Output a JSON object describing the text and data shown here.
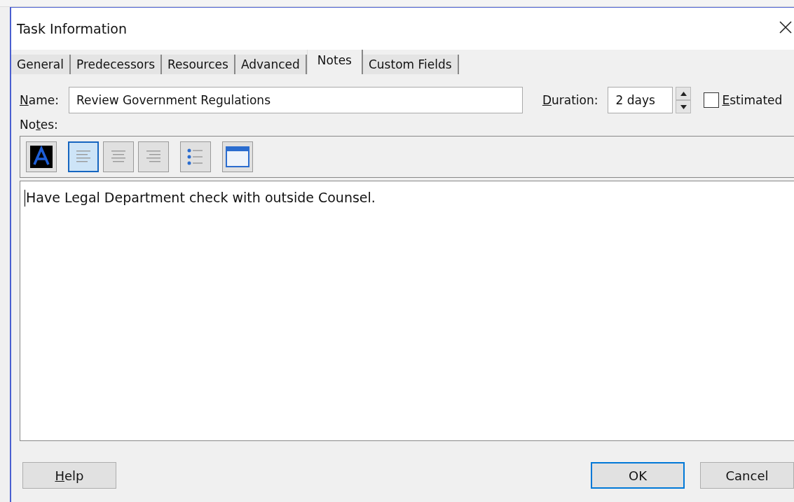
{
  "window": {
    "title": "Task Information"
  },
  "tabs": [
    {
      "label": "General",
      "selected": false
    },
    {
      "label": "Predecessors",
      "selected": false
    },
    {
      "label": "Resources",
      "selected": false
    },
    {
      "label": "Advanced",
      "selected": false
    },
    {
      "label": "Notes",
      "selected": true
    },
    {
      "label": "Custom Fields",
      "selected": false
    }
  ],
  "name_field": {
    "label": {
      "key": "N",
      "rest": "ame:"
    },
    "value": "Review Government Regulations"
  },
  "duration_field": {
    "label": {
      "key": "D",
      "rest": "uration:"
    },
    "value": "2 days"
  },
  "estimated": {
    "label": {
      "key": "E",
      "rest": "stimated"
    },
    "checked": false
  },
  "notes_label": {
    "lead": "No",
    "key": "t",
    "rest": "es:"
  },
  "toolbar": [
    {
      "kind": "font",
      "selected": false
    },
    {
      "kind": "align-left",
      "selected": true
    },
    {
      "kind": "align-center",
      "selected": false
    },
    {
      "kind": "align-right",
      "selected": false
    },
    {
      "kind": "bullets",
      "selected": false
    },
    {
      "kind": "object",
      "selected": false
    }
  ],
  "notes_text": "Have Legal Department check with outside Counsel.",
  "help_button": {
    "label": {
      "key": "H",
      "rest": "elp"
    },
    "default": false
  },
  "buttons": [
    {
      "label": {
        "rest": "OK"
      },
      "default": true
    },
    {
      "label": {
        "rest": "Cancel"
      },
      "default": false
    }
  ]
}
